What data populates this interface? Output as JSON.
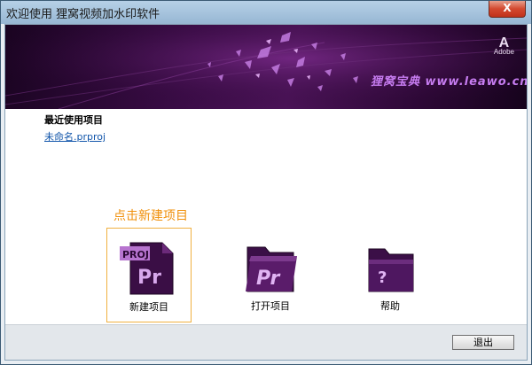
{
  "window": {
    "title": "欢迎使用 狸窝视频加水印软件",
    "close_label": "X"
  },
  "banner": {
    "adobe_glyph": "A",
    "adobe_text": "Adobe",
    "watermark": "狸窝宝典 www.leawo.cn"
  },
  "recent": {
    "heading": "最近使用项目",
    "files": [
      "未命名.prproj"
    ]
  },
  "hint": "点击新建项目",
  "actions": [
    {
      "label": "新建项目",
      "icon": "premiere-project-file-icon",
      "selected": true
    },
    {
      "label": "打开项目",
      "icon": "premiere-folder-icon",
      "selected": false
    },
    {
      "label": "帮助",
      "icon": "help-folder-icon",
      "selected": false
    }
  ],
  "icon_text": {
    "proj": "PROJ",
    "pr": "Pr",
    "help": "?"
  },
  "footer": {
    "exit_label": "退出"
  },
  "colors": {
    "accent_orange": "#f0900b",
    "link_blue": "#1155aa",
    "premiere_purple": "#4a1356",
    "close_red": "#c0321b"
  }
}
